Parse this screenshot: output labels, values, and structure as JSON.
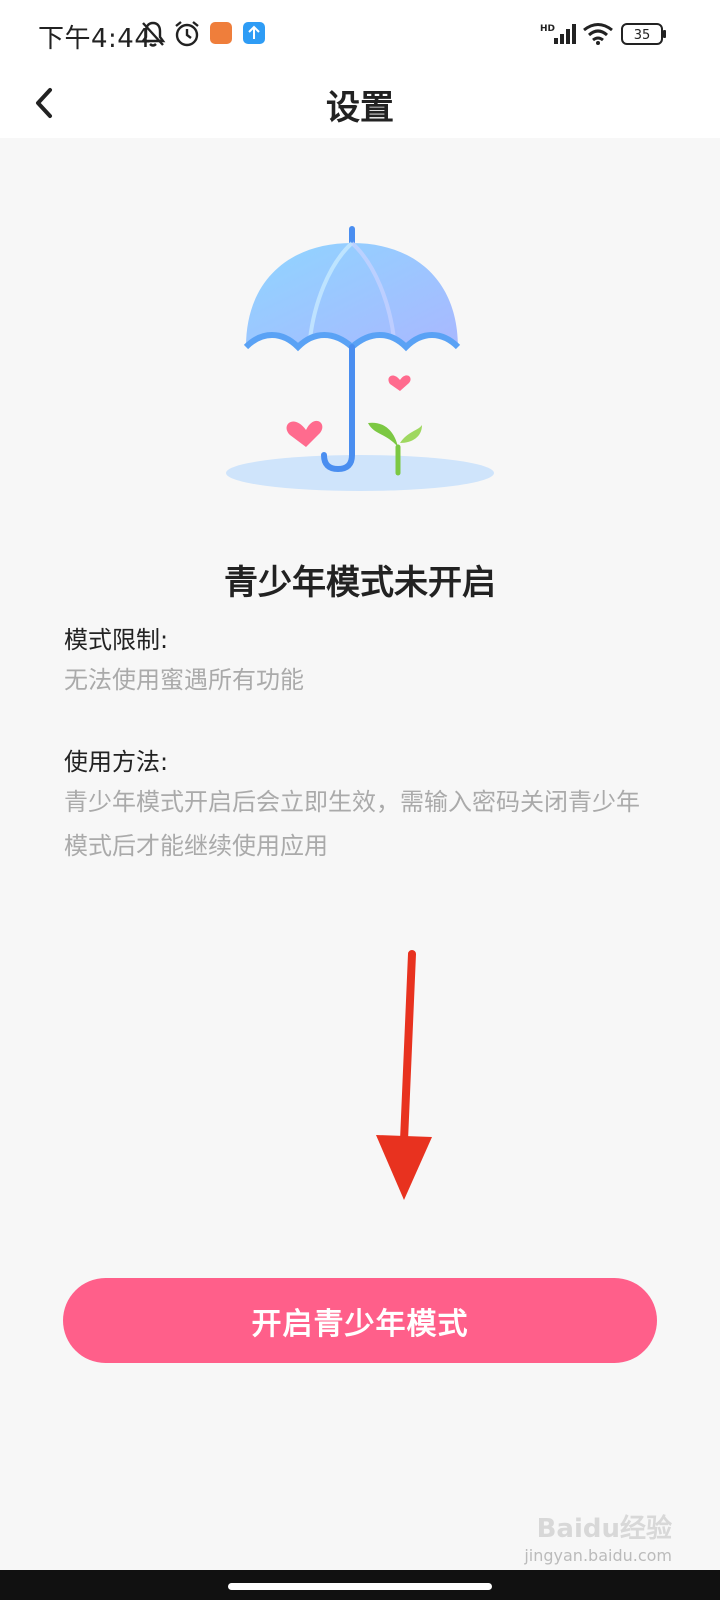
{
  "status_bar": {
    "time": "下午4:44",
    "icons": [
      "bell-off-icon",
      "alarm-icon",
      "app-notification-icon",
      "upload-icon",
      "hd-signal-icon",
      "wifi-icon",
      "battery-icon"
    ],
    "battery_level": "35",
    "signal_tag": "HD"
  },
  "nav": {
    "back_icon": "chevron-left-icon",
    "title": "设置"
  },
  "illustration": {
    "icon": "umbrella-icon",
    "colors": {
      "canopy": "#7cc4ff",
      "handle": "#4a8ef0",
      "heart": "#ff6b8e",
      "sprout": "#7cc843",
      "ground": "#cfe4fb"
    }
  },
  "main": {
    "heading": "青少年模式未开启",
    "sections": [
      {
        "label": "模式限制:",
        "text": "无法使用蜜遇所有功能"
      },
      {
        "label": "使用方法:",
        "text": "青少年模式开启后会立即生效，需输入密码关闭青少年模式后才能继续使用应用"
      }
    ]
  },
  "cta": {
    "label": "开启青少年模式",
    "color": "#ff5f8a"
  },
  "annotation": {
    "icon": "red-arrow-icon",
    "color": "#e8321f"
  },
  "watermark": {
    "text": "Baidu经验",
    "sub": "jingyan.baidu.com"
  }
}
